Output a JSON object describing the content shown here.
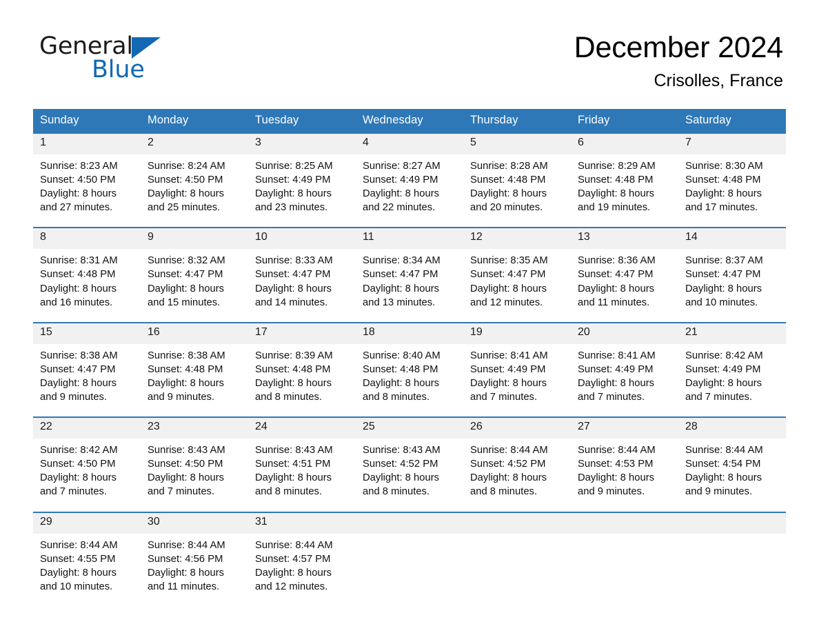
{
  "brand": {
    "name_part1": "General",
    "name_part2": "Blue",
    "logo_icon": "triangle-logo-icon",
    "accent_color": "#1268b3"
  },
  "header": {
    "title": "December 2024",
    "location": "Crisolles, France"
  },
  "theme": {
    "header_bg": "#2e78b8",
    "daynum_bg": "#f1f1f1",
    "row_border": "#2e78b8"
  },
  "calendar": {
    "weekday_headers": [
      "Sunday",
      "Monday",
      "Tuesday",
      "Wednesday",
      "Thursday",
      "Friday",
      "Saturday"
    ],
    "weeks": [
      [
        {
          "day": "1",
          "sunrise": "Sunrise: 8:23 AM",
          "sunset": "Sunset: 4:50 PM",
          "daylight_line1": "Daylight: 8 hours",
          "daylight_line2": "and 27 minutes."
        },
        {
          "day": "2",
          "sunrise": "Sunrise: 8:24 AM",
          "sunset": "Sunset: 4:50 PM",
          "daylight_line1": "Daylight: 8 hours",
          "daylight_line2": "and 25 minutes."
        },
        {
          "day": "3",
          "sunrise": "Sunrise: 8:25 AM",
          "sunset": "Sunset: 4:49 PM",
          "daylight_line1": "Daylight: 8 hours",
          "daylight_line2": "and 23 minutes."
        },
        {
          "day": "4",
          "sunrise": "Sunrise: 8:27 AM",
          "sunset": "Sunset: 4:49 PM",
          "daylight_line1": "Daylight: 8 hours",
          "daylight_line2": "and 22 minutes."
        },
        {
          "day": "5",
          "sunrise": "Sunrise: 8:28 AM",
          "sunset": "Sunset: 4:48 PM",
          "daylight_line1": "Daylight: 8 hours",
          "daylight_line2": "and 20 minutes."
        },
        {
          "day": "6",
          "sunrise": "Sunrise: 8:29 AM",
          "sunset": "Sunset: 4:48 PM",
          "daylight_line1": "Daylight: 8 hours",
          "daylight_line2": "and 19 minutes."
        },
        {
          "day": "7",
          "sunrise": "Sunrise: 8:30 AM",
          "sunset": "Sunset: 4:48 PM",
          "daylight_line1": "Daylight: 8 hours",
          "daylight_line2": "and 17 minutes."
        }
      ],
      [
        {
          "day": "8",
          "sunrise": "Sunrise: 8:31 AM",
          "sunset": "Sunset: 4:48 PM",
          "daylight_line1": "Daylight: 8 hours",
          "daylight_line2": "and 16 minutes."
        },
        {
          "day": "9",
          "sunrise": "Sunrise: 8:32 AM",
          "sunset": "Sunset: 4:47 PM",
          "daylight_line1": "Daylight: 8 hours",
          "daylight_line2": "and 15 minutes."
        },
        {
          "day": "10",
          "sunrise": "Sunrise: 8:33 AM",
          "sunset": "Sunset: 4:47 PM",
          "daylight_line1": "Daylight: 8 hours",
          "daylight_line2": "and 14 minutes."
        },
        {
          "day": "11",
          "sunrise": "Sunrise: 8:34 AM",
          "sunset": "Sunset: 4:47 PM",
          "daylight_line1": "Daylight: 8 hours",
          "daylight_line2": "and 13 minutes."
        },
        {
          "day": "12",
          "sunrise": "Sunrise: 8:35 AM",
          "sunset": "Sunset: 4:47 PM",
          "daylight_line1": "Daylight: 8 hours",
          "daylight_line2": "and 12 minutes."
        },
        {
          "day": "13",
          "sunrise": "Sunrise: 8:36 AM",
          "sunset": "Sunset: 4:47 PM",
          "daylight_line1": "Daylight: 8 hours",
          "daylight_line2": "and 11 minutes."
        },
        {
          "day": "14",
          "sunrise": "Sunrise: 8:37 AM",
          "sunset": "Sunset: 4:47 PM",
          "daylight_line1": "Daylight: 8 hours",
          "daylight_line2": "and 10 minutes."
        }
      ],
      [
        {
          "day": "15",
          "sunrise": "Sunrise: 8:38 AM",
          "sunset": "Sunset: 4:47 PM",
          "daylight_line1": "Daylight: 8 hours",
          "daylight_line2": "and 9 minutes."
        },
        {
          "day": "16",
          "sunrise": "Sunrise: 8:38 AM",
          "sunset": "Sunset: 4:48 PM",
          "daylight_line1": "Daylight: 8 hours",
          "daylight_line2": "and 9 minutes."
        },
        {
          "day": "17",
          "sunrise": "Sunrise: 8:39 AM",
          "sunset": "Sunset: 4:48 PM",
          "daylight_line1": "Daylight: 8 hours",
          "daylight_line2": "and 8 minutes."
        },
        {
          "day": "18",
          "sunrise": "Sunrise: 8:40 AM",
          "sunset": "Sunset: 4:48 PM",
          "daylight_line1": "Daylight: 8 hours",
          "daylight_line2": "and 8 minutes."
        },
        {
          "day": "19",
          "sunrise": "Sunrise: 8:41 AM",
          "sunset": "Sunset: 4:49 PM",
          "daylight_line1": "Daylight: 8 hours",
          "daylight_line2": "and 7 minutes."
        },
        {
          "day": "20",
          "sunrise": "Sunrise: 8:41 AM",
          "sunset": "Sunset: 4:49 PM",
          "daylight_line1": "Daylight: 8 hours",
          "daylight_line2": "and 7 minutes."
        },
        {
          "day": "21",
          "sunrise": "Sunrise: 8:42 AM",
          "sunset": "Sunset: 4:49 PM",
          "daylight_line1": "Daylight: 8 hours",
          "daylight_line2": "and 7 minutes."
        }
      ],
      [
        {
          "day": "22",
          "sunrise": "Sunrise: 8:42 AM",
          "sunset": "Sunset: 4:50 PM",
          "daylight_line1": "Daylight: 8 hours",
          "daylight_line2": "and 7 minutes."
        },
        {
          "day": "23",
          "sunrise": "Sunrise: 8:43 AM",
          "sunset": "Sunset: 4:50 PM",
          "daylight_line1": "Daylight: 8 hours",
          "daylight_line2": "and 7 minutes."
        },
        {
          "day": "24",
          "sunrise": "Sunrise: 8:43 AM",
          "sunset": "Sunset: 4:51 PM",
          "daylight_line1": "Daylight: 8 hours",
          "daylight_line2": "and 8 minutes."
        },
        {
          "day": "25",
          "sunrise": "Sunrise: 8:43 AM",
          "sunset": "Sunset: 4:52 PM",
          "daylight_line1": "Daylight: 8 hours",
          "daylight_line2": "and 8 minutes."
        },
        {
          "day": "26",
          "sunrise": "Sunrise: 8:44 AM",
          "sunset": "Sunset: 4:52 PM",
          "daylight_line1": "Daylight: 8 hours",
          "daylight_line2": "and 8 minutes."
        },
        {
          "day": "27",
          "sunrise": "Sunrise: 8:44 AM",
          "sunset": "Sunset: 4:53 PM",
          "daylight_line1": "Daylight: 8 hours",
          "daylight_line2": "and 9 minutes."
        },
        {
          "day": "28",
          "sunrise": "Sunrise: 8:44 AM",
          "sunset": "Sunset: 4:54 PM",
          "daylight_line1": "Daylight: 8 hours",
          "daylight_line2": "and 9 minutes."
        }
      ],
      [
        {
          "day": "29",
          "sunrise": "Sunrise: 8:44 AM",
          "sunset": "Sunset: 4:55 PM",
          "daylight_line1": "Daylight: 8 hours",
          "daylight_line2": "and 10 minutes."
        },
        {
          "day": "30",
          "sunrise": "Sunrise: 8:44 AM",
          "sunset": "Sunset: 4:56 PM",
          "daylight_line1": "Daylight: 8 hours",
          "daylight_line2": "and 11 minutes."
        },
        {
          "day": "31",
          "sunrise": "Sunrise: 8:44 AM",
          "sunset": "Sunset: 4:57 PM",
          "daylight_line1": "Daylight: 8 hours",
          "daylight_line2": "and 12 minutes."
        },
        {
          "day": "",
          "sunrise": "",
          "sunset": "",
          "daylight_line1": "",
          "daylight_line2": ""
        },
        {
          "day": "",
          "sunrise": "",
          "sunset": "",
          "daylight_line1": "",
          "daylight_line2": ""
        },
        {
          "day": "",
          "sunrise": "",
          "sunset": "",
          "daylight_line1": "",
          "daylight_line2": ""
        },
        {
          "day": "",
          "sunrise": "",
          "sunset": "",
          "daylight_line1": "",
          "daylight_line2": ""
        }
      ]
    ]
  }
}
